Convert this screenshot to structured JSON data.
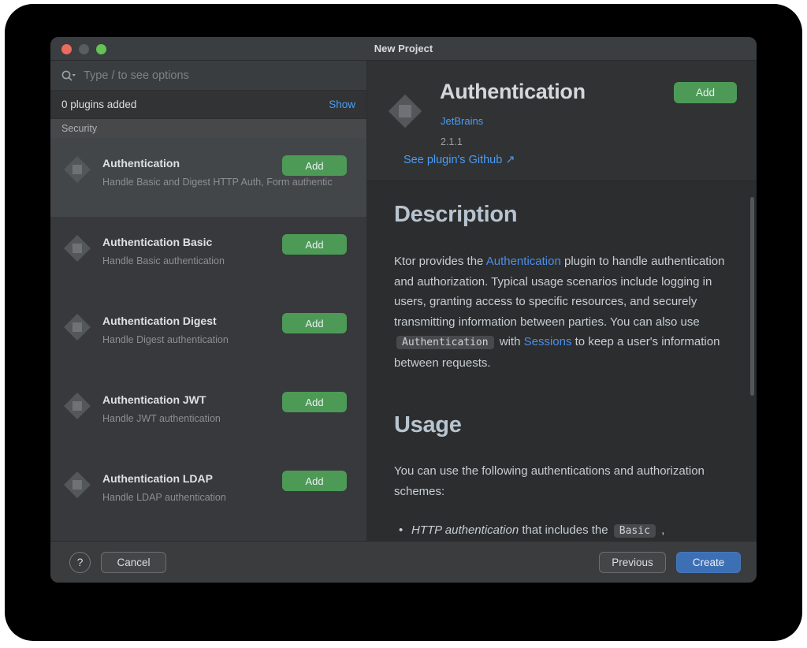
{
  "window": {
    "title": "New Project"
  },
  "traffic_lights": {
    "close": "#EC6A5E",
    "minimize": "#5A5D5F",
    "zoom": "#61C454"
  },
  "left_panel": {
    "search_placeholder": "Type / to see options",
    "plugins_added": "0 plugins added",
    "show_link": "Show",
    "section": "Security",
    "add_label": "Add",
    "plugins": [
      {
        "name": "Authentication",
        "description": "Handle Basic and Digest HTTP Auth, Form authentic",
        "selected": true
      },
      {
        "name": "Authentication Basic",
        "description": "Handle Basic authentication",
        "selected": false
      },
      {
        "name": "Authentication Digest",
        "description": "Handle Digest authentication",
        "selected": false
      },
      {
        "name": "Authentication JWT",
        "description": "Handle JWT authentication",
        "selected": false
      },
      {
        "name": "Authentication LDAP",
        "description": "Handle LDAP authentication",
        "selected": false
      }
    ]
  },
  "details": {
    "title": "Authentication",
    "add_label": "Add",
    "vendor": "JetBrains",
    "version": "2.1.1",
    "github_link": "See plugin's Github ↗",
    "description_heading": "Description",
    "description_parts": [
      {
        "t": "text",
        "s": "Ktor provides the "
      },
      {
        "t": "link",
        "s": "Authentication"
      },
      {
        "t": "text",
        "s": " plugin to handle authentication and authorization. Typical usage scenarios include logging in users, granting access to specific resources, and securely transmitting information between parties. You can also use "
      },
      {
        "t": "code",
        "s": "Authentication"
      },
      {
        "t": "text",
        "s": " with "
      },
      {
        "t": "link",
        "s": "Sessions"
      },
      {
        "t": "text",
        "s": " to keep a user's information between requests."
      }
    ],
    "usage_heading": "Usage",
    "usage_intro": "You can use the following authentications and authorization schemes:",
    "bullet_parts": [
      {
        "t": "em",
        "s": "HTTP authentication"
      },
      {
        "t": "text",
        "s": " that includes the "
      },
      {
        "t": "code",
        "s": "Basic"
      },
      {
        "t": "text",
        "s": " ,"
      }
    ]
  },
  "footer": {
    "help": "?",
    "cancel": "Cancel",
    "previous": "Previous",
    "create": "Create"
  },
  "colors": {
    "add_button_green": "#4D9A57",
    "create_button_blue": "#3D6FB5",
    "link_blue_bright": "#4B9CF5",
    "link_blue_content": "#4D8FE8",
    "panel_bg": "#37393C",
    "content_bg": "#2B2D2E"
  }
}
